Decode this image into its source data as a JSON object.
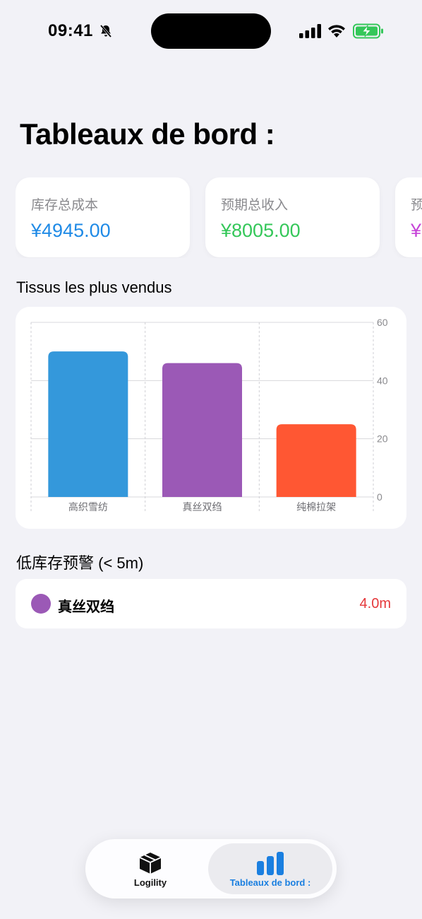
{
  "status_bar": {
    "time": "09:41",
    "icons": [
      "bell-slash-icon",
      "cellular-signal-icon",
      "wifi-icon",
      "battery-charging-icon"
    ]
  },
  "page": {
    "title": "Tableaux de bord :"
  },
  "stats": [
    {
      "label": "库存总成本",
      "value": "¥4945.00",
      "color": "#1f8ae6"
    },
    {
      "label": "预期总收入",
      "value": "¥8005.00",
      "color": "#34c759"
    },
    {
      "label": "预",
      "value": "¥",
      "color": "#c644d8"
    }
  ],
  "sections": {
    "top_fabrics_title": "Tissus les plus vendus",
    "low_stock_title": "低库存预警 (< 5m)"
  },
  "chart_data": {
    "type": "bar",
    "categories": [
      "高织雪纺",
      "真丝双绉",
      "纯棉拉架"
    ],
    "values": [
      50,
      46,
      25
    ],
    "colors": [
      "#3498db",
      "#9b59b6",
      "#ff5733"
    ],
    "ylim": [
      0,
      60
    ],
    "yticks": [
      0,
      20,
      40,
      60
    ],
    "grid": true,
    "y_axis_side": "right"
  },
  "low_stock": [
    {
      "name": "真丝双绉",
      "quantity": "4.0m",
      "dot_color": "#9b59b6",
      "quantity_color": "#e5383b"
    }
  ],
  "tab_bar": {
    "tabs": [
      {
        "label": "Logility",
        "icon": "box-icon",
        "active": false
      },
      {
        "label": "Tableaux de bord :",
        "icon": "bar-chart-icon",
        "active": true
      }
    ],
    "active_color": "#1a7fe0"
  }
}
